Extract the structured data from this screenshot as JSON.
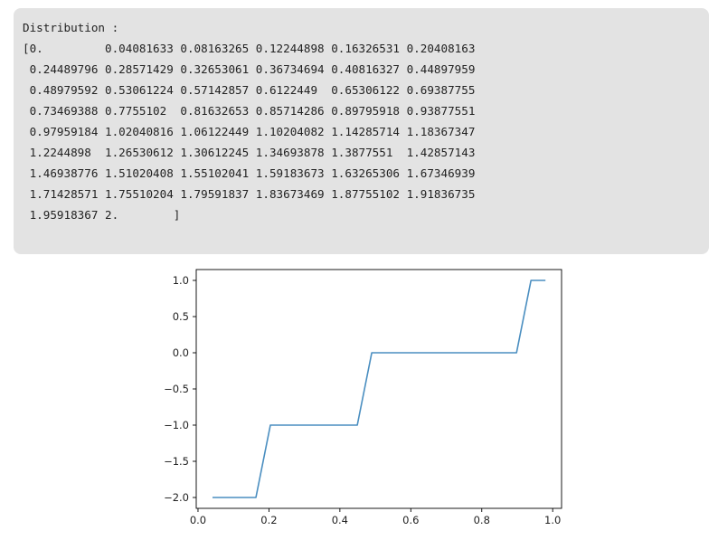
{
  "output": {
    "label": "Distribution :",
    "array_lines": [
      "[0.         0.04081633 0.08163265 0.12244898 0.16326531 0.20408163",
      " 0.24489796 0.28571429 0.32653061 0.36734694 0.40816327 0.44897959",
      " 0.48979592 0.53061224 0.57142857 0.6122449  0.65306122 0.69387755",
      " 0.73469388 0.7755102  0.81632653 0.85714286 0.89795918 0.93877551",
      " 0.97959184 1.02040816 1.06122449 1.10204082 1.14285714 1.18367347",
      " 1.2244898  1.26530612 1.30612245 1.34693878 1.3877551  1.42857143",
      " 1.46938776 1.51020408 1.55102041 1.59183673 1.63265306 1.67346939",
      " 1.71428571 1.75510204 1.79591837 1.83673469 1.87755102 1.91836735",
      " 1.95918367 2.        ]"
    ]
  },
  "chart_data": {
    "type": "line",
    "title": "",
    "xlabel": "",
    "ylabel": "",
    "xlim": [
      -0.005,
      1.025
    ],
    "ylim": [
      -2.15,
      1.15
    ],
    "xticks": [
      0.0,
      0.2,
      0.4,
      0.6,
      0.8,
      1.0
    ],
    "xtick_labels": [
      "0.0",
      "0.2",
      "0.4",
      "0.6",
      "0.8",
      "1.0"
    ],
    "yticks": [
      1.0,
      0.5,
      0.0,
      -0.5,
      -1.0,
      -1.5,
      -2.0
    ],
    "ytick_labels": [
      "1.0",
      "0.5",
      "0.0",
      "−0.5",
      "−1.0",
      "−1.5",
      "−2.0"
    ],
    "grid": false,
    "series": [
      {
        "color": "#4a8ec0",
        "x": [
          0.0408,
          0.1633,
          0.2041,
          0.449,
          0.4898,
          0.898,
          0.9388,
          0.9796
        ],
        "y": [
          -2,
          -2,
          -1,
          -1,
          0,
          0,
          1,
          1
        ]
      }
    ]
  }
}
